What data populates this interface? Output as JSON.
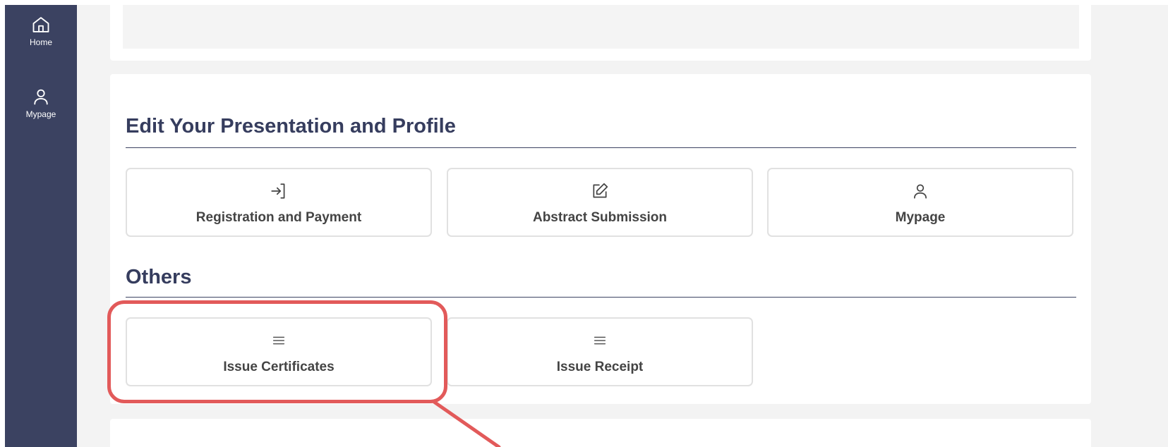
{
  "sidebar": {
    "items": [
      {
        "label": "Home",
        "icon": "home-icon"
      },
      {
        "label": "Mypage",
        "icon": "user-icon"
      }
    ]
  },
  "sections": [
    {
      "title": "Edit Your Presentation and Profile",
      "cards": [
        {
          "label": "Registration and Payment",
          "icon": "login-arrow-icon"
        },
        {
          "label": "Abstract Submission",
          "icon": "edit-icon"
        },
        {
          "label": "Mypage",
          "icon": "user-icon"
        }
      ]
    },
    {
      "title": "Others",
      "cards": [
        {
          "label": "Issue Certificates",
          "icon": "menu-lines-icon"
        },
        {
          "label": "Issue Receipt",
          "icon": "menu-lines-icon"
        }
      ]
    }
  ],
  "colors": {
    "sidebar": "#3b4261",
    "heading": "#363d5e",
    "highlight": "#e25a5a",
    "background": "#f3f3f3"
  }
}
